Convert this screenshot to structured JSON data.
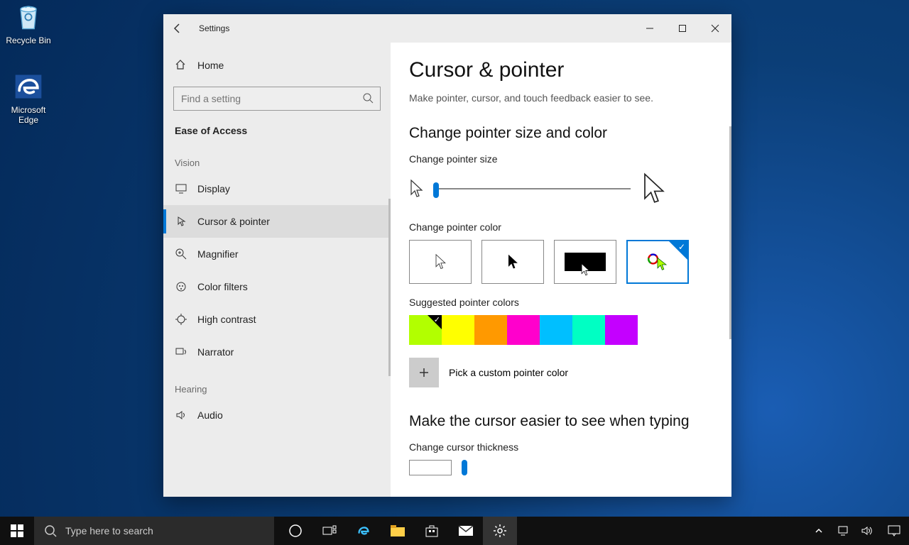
{
  "desktop": {
    "recycle_bin": "Recycle Bin",
    "edge": "Microsoft Edge"
  },
  "window": {
    "title": "Settings",
    "home": "Home",
    "search_placeholder": "Find a setting",
    "category": "Ease of Access",
    "groups": {
      "vision": "Vision",
      "hearing": "Hearing"
    },
    "nav": {
      "display": "Display",
      "cursor_pointer": "Cursor & pointer",
      "magnifier": "Magnifier",
      "color_filters": "Color filters",
      "high_contrast": "High contrast",
      "narrator": "Narrator",
      "audio": "Audio"
    }
  },
  "page": {
    "title": "Cursor & pointer",
    "desc": "Make pointer, cursor, and touch feedback easier to see.",
    "section_size_color": "Change pointer size and color",
    "label_size": "Change pointer size",
    "label_color": "Change pointer color",
    "label_suggested": "Suggested pointer colors",
    "custom_color": "Pick a custom pointer color",
    "section_cursor": "Make the cursor easier to see when typing",
    "label_thickness": "Change cursor thickness",
    "suggested_colors": [
      "#b2ff00",
      "#ffff00",
      "#ff9900",
      "#ff00cc",
      "#00bfff",
      "#00ffc3",
      "#c400ff"
    ]
  },
  "taskbar": {
    "search_placeholder": "Type here to search"
  }
}
